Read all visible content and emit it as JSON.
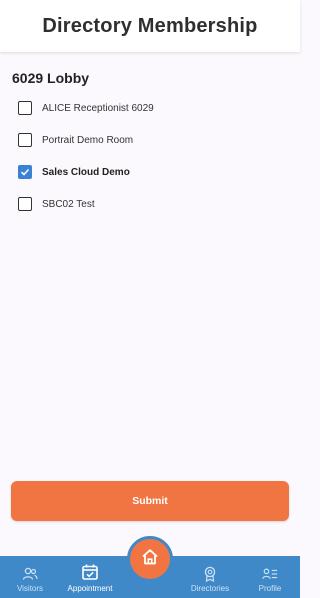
{
  "header": {
    "title": "Directory Membership"
  },
  "group": {
    "title": "6029 Lobby",
    "directories": [
      {
        "label": "ALICE Receptionist 6029",
        "checked": false
      },
      {
        "label": "Portrait Demo Room",
        "checked": false
      },
      {
        "label": "Sales Cloud Demo",
        "checked": true
      },
      {
        "label": "SBC02 Test",
        "checked": false
      }
    ]
  },
  "actions": {
    "submit_label": "Submit"
  },
  "tabbar": {
    "tabs": [
      {
        "label": "Visitors",
        "icon": "visitors-icon"
      },
      {
        "label": "Appointment",
        "icon": "calendar-icon",
        "active": true
      },
      {
        "label": "",
        "icon": "home-icon"
      },
      {
        "label": "Directories",
        "icon": "directories-icon"
      },
      {
        "label": "Profile",
        "icon": "profile-icon"
      }
    ]
  },
  "colors": {
    "accent_orange": "#f07542",
    "tabbar_blue": "#3f89c8",
    "checkbox_blue": "#3b82d6"
  }
}
